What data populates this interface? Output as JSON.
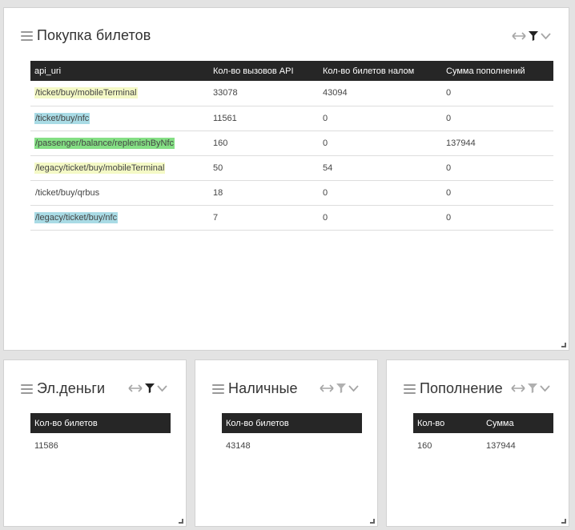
{
  "main": {
    "title": "Покупка билетов",
    "columns": [
      "api_uri",
      "Кол-во вызовов API",
      "Кол-во билетов налом",
      "Сумма пополнений"
    ],
    "rows": [
      {
        "uri": "/ticket/buy/mobileTerminal",
        "highlight": "#f4f9c6",
        "api_calls": "33078",
        "cash_tickets": "43094",
        "replenish_sum": "0"
      },
      {
        "uri": "/ticket/buy/nfc",
        "highlight": "#a9dbe5",
        "api_calls": "11561",
        "cash_tickets": "0",
        "replenish_sum": "0"
      },
      {
        "uri": "/passenger/balance/replenishByNfc",
        "highlight": "#84df84",
        "api_calls": "160",
        "cash_tickets": "0",
        "replenish_sum": "137944"
      },
      {
        "uri": "/legacy/ticket/buy/mobileTerminal",
        "highlight": "#f4f9c6",
        "api_calls": "50",
        "cash_tickets": "54",
        "replenish_sum": "0"
      },
      {
        "uri": "/ticket/buy/qrbus",
        "highlight": "",
        "api_calls": "18",
        "cash_tickets": "0",
        "replenish_sum": "0"
      },
      {
        "uri": "/legacy/ticket/buy/nfc",
        "highlight": "#a9dbe5",
        "api_calls": "7",
        "cash_tickets": "0",
        "replenish_sum": "0"
      }
    ]
  },
  "electronic": {
    "title": "Эл.деньги",
    "columns": [
      "Кол-во билетов"
    ],
    "row": [
      "11586"
    ]
  },
  "cash": {
    "title": "Наличные",
    "columns": [
      "Кол-во билетов"
    ],
    "row": [
      "43148"
    ]
  },
  "replenish": {
    "title": "Пополнение",
    "columns": [
      "Кол-во",
      "Сумма"
    ],
    "row": [
      "160",
      "137944"
    ]
  },
  "icons": {
    "menu": "hamburger-menu-icon",
    "resize": "horizontal-arrows-icon",
    "filter": "filter-funnel-icon",
    "collapse": "chevron-down-icon",
    "corner": "resize-corner-icon"
  },
  "colors": {
    "table_header_bg": "#262626",
    "filter_active": "#222222",
    "filter_inactive": "#b0b0b0"
  }
}
